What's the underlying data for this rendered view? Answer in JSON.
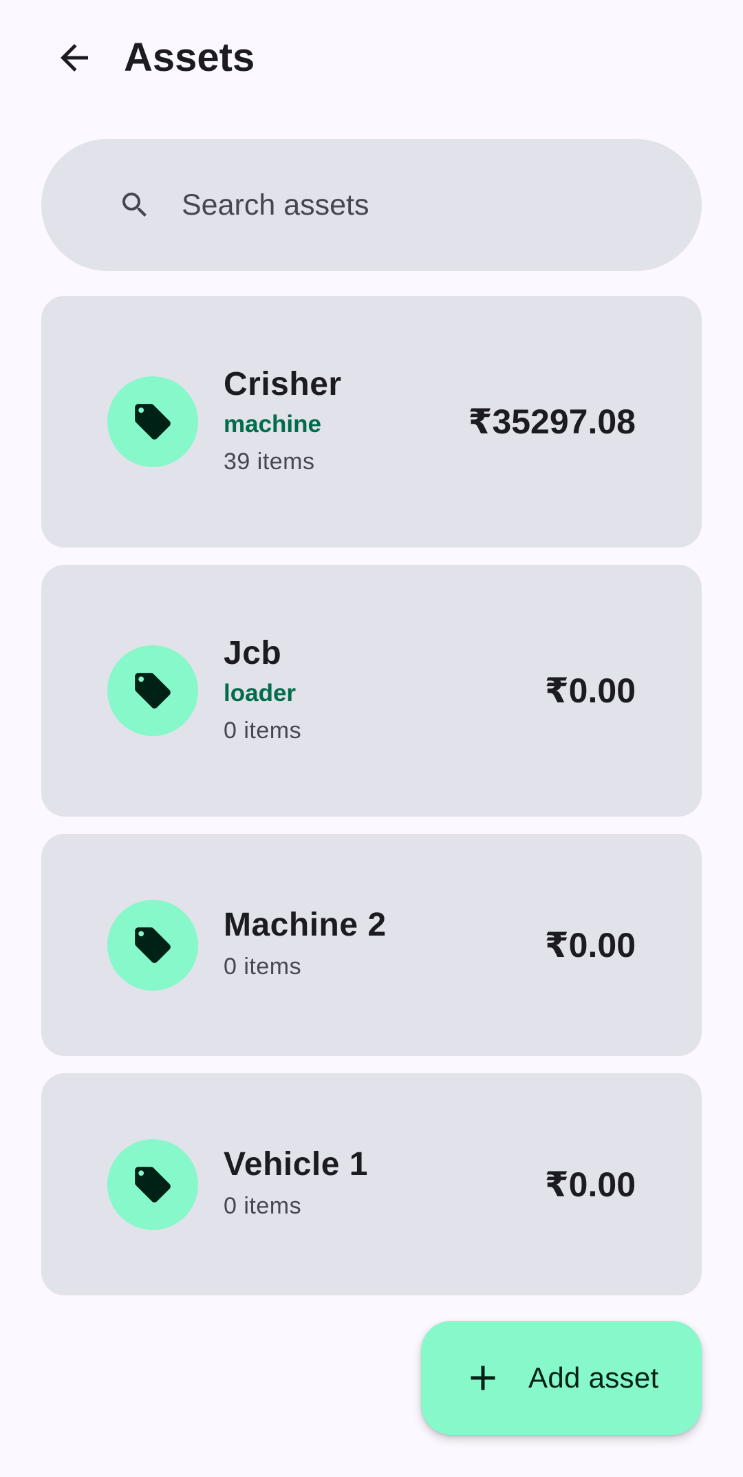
{
  "header": {
    "title": "Assets",
    "back_icon": "arrow-back-icon"
  },
  "search": {
    "placeholder": "Search assets",
    "value": "",
    "icon": "search-icon"
  },
  "assets": [
    {
      "name": "Crisher",
      "category": "machine",
      "count": "39 items",
      "value": "₹35297.08",
      "icon": "tag-icon"
    },
    {
      "name": "Jcb",
      "category": "loader",
      "count": "0 items",
      "value": "₹0.00",
      "icon": "tag-icon"
    },
    {
      "name": "Machine 2",
      "category": "",
      "count": "0 items",
      "value": "₹0.00",
      "icon": "tag-icon"
    },
    {
      "name": "Vehicle 1",
      "category": "",
      "count": "0 items",
      "value": "₹0.00",
      "icon": "tag-icon"
    }
  ],
  "fab": {
    "label": "Add asset",
    "icon": "plus-icon"
  },
  "colors": {
    "background": "#fcf8ff",
    "surface": "#e2e2ea",
    "accent_container": "#86f8c9",
    "category_text": "#006c4c",
    "on_accent": "#002116"
  }
}
